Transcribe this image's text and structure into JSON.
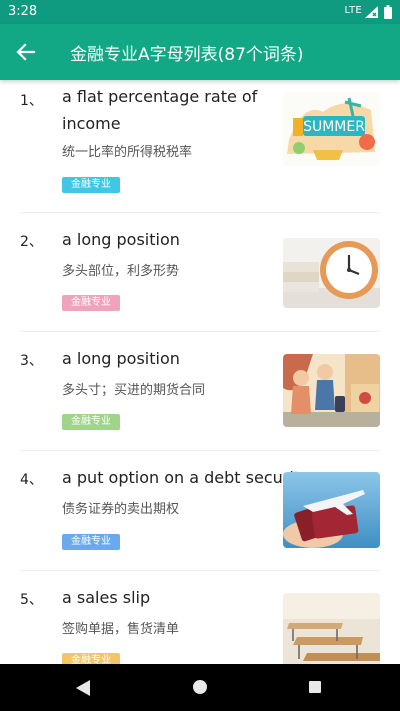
{
  "status": {
    "time": "3:28",
    "network": "LTE"
  },
  "appbar": {
    "title": "金融专业A字母列表(87个词条)"
  },
  "items": [
    {
      "number": "1、",
      "term": "a flat percentage rate of income",
      "meaning": "统一比率的所得税税率",
      "tag": "金融专业",
      "tag_color": "#3fc7e3",
      "image": "summer-illustration"
    },
    {
      "number": "2、",
      "term": "a long position",
      "meaning": "多头部位，利多形势",
      "tag": "金融专业",
      "tag_color": "#f0a3bd",
      "image": "alarm-clock-on-books"
    },
    {
      "number": "3、",
      "term": "a long position",
      "meaning": "多头寸；买进的期货合同",
      "tag": "金融专业",
      "tag_color": "#9fd48a",
      "image": "travelers-illustration"
    },
    {
      "number": "4、",
      "term": "a put option on a debt security",
      "meaning": "债务证券的卖出期权",
      "tag": "金融专业",
      "tag_color": "#6aa9f0",
      "image": "passport-and-airplane"
    },
    {
      "number": "5、",
      "term": "a sales slip",
      "meaning": "签购单据，售货清单",
      "tag": "金融专业",
      "tag_color": "#f2c46b",
      "image": "classroom-desks"
    }
  ]
}
